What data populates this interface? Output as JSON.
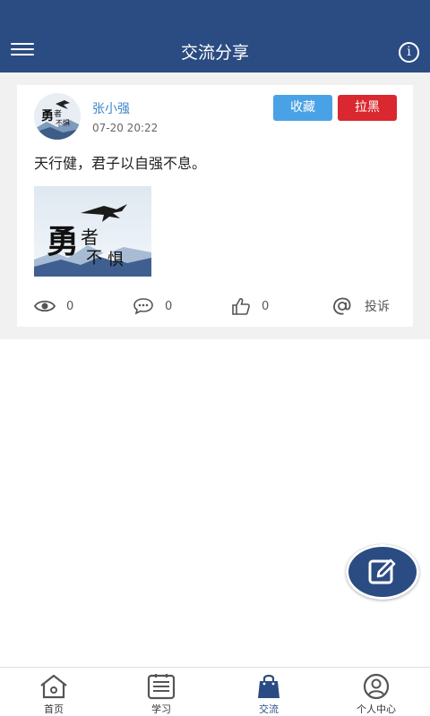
{
  "header": {
    "title": "交流分享",
    "menu_icon": "hamburger-menu-icon",
    "info_icon": "info-icon",
    "info_glyph": "i"
  },
  "post": {
    "username": "张小强",
    "time": "07-20 20:22",
    "favorite_label": "收藏",
    "block_label": "拉黑",
    "text": "天行健，君子以自强不息。",
    "avatar_calligraphy": "勇者不惧",
    "image_calligraphy": "勇者不惧",
    "stats": {
      "views": "0",
      "comments": "0",
      "likes": "0",
      "report_label": "投诉"
    }
  },
  "tabs": [
    {
      "label": "首页",
      "icon": "home-icon"
    },
    {
      "label": "学习",
      "icon": "book-icon"
    },
    {
      "label": "交流",
      "icon": "shopping-bag-icon"
    },
    {
      "label": "个人中心",
      "icon": "user-icon"
    }
  ],
  "colors": {
    "header_bg": "#2b4c82",
    "favorite_button": "#4aa2e6",
    "block_button": "#d9282f",
    "username": "#3d86c8"
  }
}
